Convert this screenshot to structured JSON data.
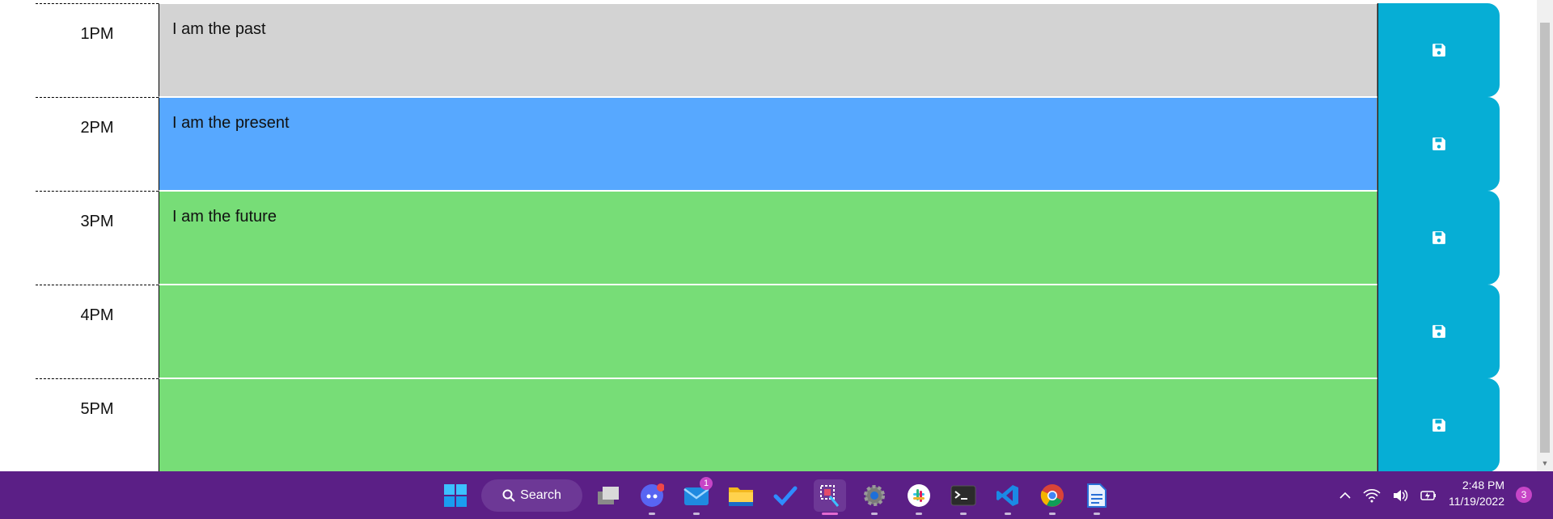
{
  "scheduler": {
    "rows": [
      {
        "hour": "1PM",
        "text": "I am the past",
        "state": "past"
      },
      {
        "hour": "2PM",
        "text": "I am the present",
        "state": "present"
      },
      {
        "hour": "3PM",
        "text": "I am the future",
        "state": "future"
      },
      {
        "hour": "4PM",
        "text": "",
        "state": "future"
      },
      {
        "hour": "5PM",
        "text": "",
        "state": "future"
      }
    ],
    "save_icon": "floppy-disk-icon",
    "colors": {
      "past": "#d3d3d3",
      "present": "#57a8ff",
      "future": "#77dd77",
      "save": "#06aed5"
    }
  },
  "taskbar": {
    "search_label": "Search",
    "mail_badge": "1",
    "clock_time": "2:48 PM",
    "clock_date": "11/19/2022",
    "notification_count": "3",
    "background": "#5b1f86"
  }
}
